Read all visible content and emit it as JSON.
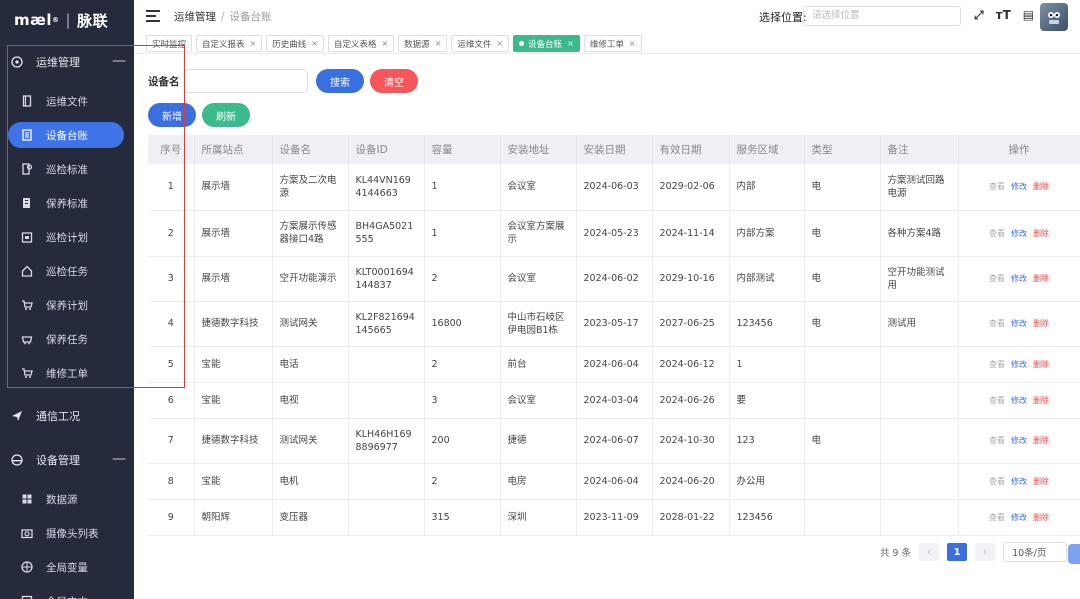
{
  "brand": {
    "logo": "mæl",
    "reg": "®",
    "sep": "|",
    "name": "脉联"
  },
  "sidebar": {
    "group1": {
      "label": "运维管理",
      "collapse": "—"
    },
    "items1": [
      {
        "label": "运维文件",
        "icon": "file-icon"
      },
      {
        "label": "设备台账",
        "icon": "ledger-icon",
        "active": true
      },
      {
        "label": "巡检标准",
        "icon": "inspect-standard-icon"
      },
      {
        "label": "保养标准",
        "icon": "maintain-standard-icon"
      },
      {
        "label": "巡检计划",
        "icon": "calendar-icon"
      },
      {
        "label": "巡检任务",
        "icon": "home-icon"
      },
      {
        "label": "保养计划",
        "icon": "cart-icon"
      },
      {
        "label": "保养任务",
        "icon": "basket-icon"
      },
      {
        "label": "维修工单",
        "icon": "cart-icon"
      }
    ],
    "group2": {
      "label": "通信工况"
    },
    "group3": {
      "label": "设备管理",
      "collapse": "—"
    },
    "items3": [
      {
        "label": "数据源",
        "icon": "grid-icon"
      },
      {
        "label": "摄像头列表",
        "icon": "camera-icon"
      },
      {
        "label": "全局变量",
        "icon": "globe-icon"
      },
      {
        "label": "全局文本",
        "icon": "text-icon"
      }
    ]
  },
  "header": {
    "breadcrumb_parent": "运维管理",
    "breadcrumb_sep": "/",
    "breadcrumb_current": "设备台账",
    "location_label": "选择位置:",
    "location_placeholder": "请选择位置",
    "icon_fullscreen": "⤢",
    "icon_fontsize": "тT",
    "icon_doc": "▤"
  },
  "tags": [
    {
      "label": "实时监控",
      "closable": false
    },
    {
      "label": "自定义报表",
      "closable": true
    },
    {
      "label": "历史曲线",
      "closable": true
    },
    {
      "label": "自定义表格",
      "closable": true
    },
    {
      "label": "数据源",
      "closable": true
    },
    {
      "label": "运维文件",
      "closable": true
    },
    {
      "label": "设备台账",
      "closable": true,
      "active": true
    },
    {
      "label": "维修工单",
      "closable": true
    }
  ],
  "search": {
    "label": "设备名",
    "value": "",
    "search_btn": "搜索",
    "clear_btn": "清空",
    "add_btn": "新增",
    "refresh_btn": "刷新"
  },
  "table": {
    "headers": [
      "序号",
      "所属站点",
      "设备名",
      "设备ID",
      "容量",
      "安装地址",
      "安装日期",
      "有效日期",
      "服务区域",
      "类型",
      "备注",
      "操作"
    ],
    "ops": {
      "view": "查看",
      "edit": "修改",
      "del": "删除"
    },
    "rows": [
      [
        "1",
        "展示墙",
        "方案及二次电源",
        "KL44VN1694144663",
        "1",
        "会议室",
        "2024-06-03",
        "2029-02-06",
        "内部",
        "电",
        "方案测试回路电源"
      ],
      [
        "2",
        "展示墙",
        "方案展示传感器接口4路",
        "BH4GA5021555",
        "1",
        "会议室方案展示",
        "2024-05-23",
        "2024-11-14",
        "内部方案",
        "电",
        "各种方案4路"
      ],
      [
        "3",
        "展示墙",
        "空开功能演示",
        "KLT0001694144837",
        "2",
        "会议室",
        "2024-06-02",
        "2029-10-16",
        "内部测试",
        "电",
        "空开功能测试用"
      ],
      [
        "4",
        "捷德数字科技",
        "测试网关",
        "KL2F821694145665",
        "16800",
        "中山市石岐区伊电园B1栋",
        "2023-05-17",
        "2027-06-25",
        "123456",
        "电",
        "测试用"
      ],
      [
        "5",
        "宝能",
        "电话",
        "",
        "2",
        "前台",
        "2024-06-04",
        "2024-06-12",
        "1",
        "",
        ""
      ],
      [
        "6",
        "宝能",
        "电视",
        "",
        "3",
        "会议室",
        "2024-03-04",
        "2024-06-26",
        "要",
        "",
        ""
      ],
      [
        "7",
        "捷德数字科技",
        "测试网关",
        "KLH46H1698896977",
        "200",
        "捷德",
        "2024-06-07",
        "2024-10-30",
        "123",
        "电",
        ""
      ],
      [
        "8",
        "宝能",
        "电机",
        "",
        "2",
        "电房",
        "2024-06-04",
        "2024-06-20",
        "办公用",
        "",
        ""
      ],
      [
        "9",
        "朝阳辉",
        "变压器",
        "",
        "315",
        "深圳",
        "2023-11-09",
        "2028-01-22",
        "123456",
        "",
        ""
      ]
    ]
  },
  "pager": {
    "total": "共 9 条",
    "prev": "‹",
    "page": "1",
    "next": "›",
    "size": "10条/页"
  }
}
